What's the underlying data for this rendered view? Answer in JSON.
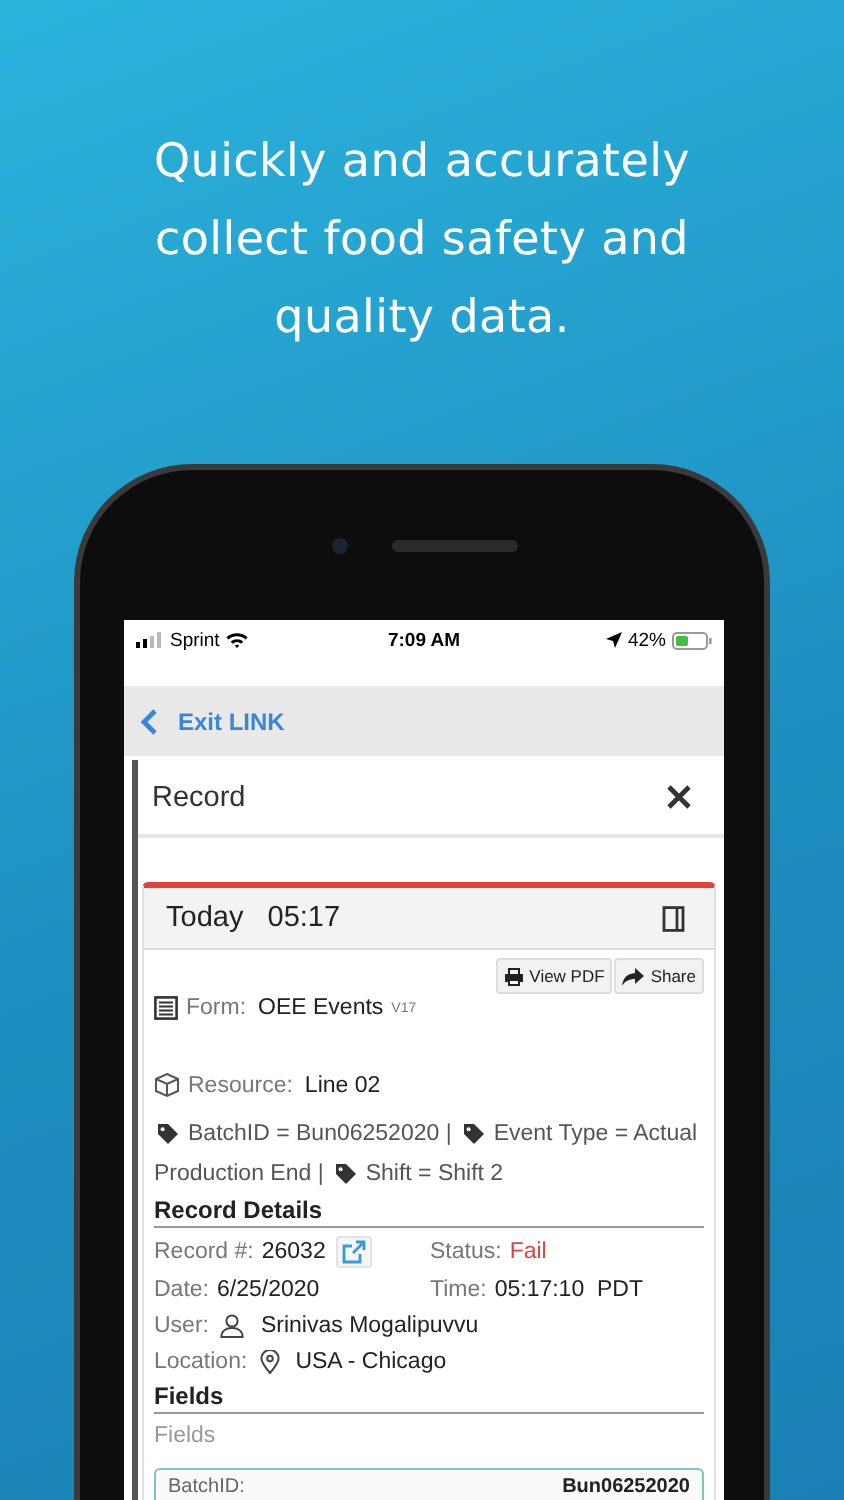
{
  "headline": "Quickly and accurately collect food safety and quality data.",
  "status_bar": {
    "carrier": "Sprint",
    "time": "7:09 AM",
    "battery": "42%"
  },
  "nav": {
    "back_label": "Exit LINK"
  },
  "modal": {
    "title": "Record"
  },
  "record": {
    "day": "Today",
    "time": "05:17",
    "buttons": [
      "View PDF",
      "Share"
    ],
    "form_label": "Form:",
    "form": "OEE Events",
    "version": "V17",
    "resource_label": "Resource:",
    "resource": "Line 02",
    "tags": [
      {
        "kind": "tag",
        "text": "BatchID = Bun06252020 |"
      },
      {
        "kind": "tag",
        "text": "Event Type = Actual"
      },
      {
        "kind": "continuation",
        "text": "Production End |"
      },
      {
        "kind": "tag",
        "text": "Shift = Shift 2"
      }
    ],
    "details_title": "Record Details",
    "record_label": "Record #:",
    "record_number": "26032",
    "status_label": "Status:",
    "status": "Fail",
    "failed": true,
    "date_label": "Date:",
    "date": "6/25/2020",
    "time_label": "Time:",
    "time_value": "05:17:10  PDT",
    "user_label": "User:",
    "user": "Srinivas Mogalipuvvu",
    "location_label": "Location:",
    "location": "USA - Chicago",
    "fields_title": "Fields",
    "fields_caption": "Fields",
    "fields": [
      {
        "label": "BatchID:",
        "value": "Bun06252020"
      }
    ]
  }
}
